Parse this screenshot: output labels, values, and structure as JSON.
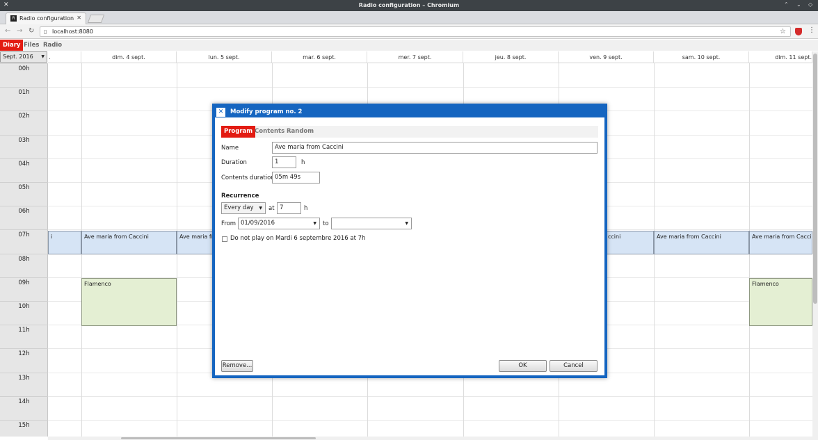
{
  "window": {
    "title": "Radio configuration – Chromium"
  },
  "tab": {
    "favicon": "R",
    "title": "Radio configuration"
  },
  "address_bar": {
    "url": "localhost:8080"
  },
  "app_menu": [
    {
      "label": "Diary",
      "active": true
    },
    {
      "label": "Files",
      "active": false
    },
    {
      "label": "Radio",
      "active": false
    }
  ],
  "calendar": {
    "month_select": "Sept. 2016",
    "partial_left_header": ".",
    "days": [
      "dim. 4 sept.",
      "lun. 5 sept.",
      "mar. 6 sept.",
      "mer. 7 sept.",
      "jeu. 8 sept.",
      "ven. 9 sept.",
      "sam. 10 sept.",
      "dim. 11 sept."
    ],
    "hours": [
      "00h",
      "01h",
      "02h",
      "03h",
      "04h",
      "05h",
      "06h",
      "07h",
      "08h",
      "09h",
      "10h",
      "11h",
      "12h",
      "13h",
      "14h",
      "15h"
    ],
    "events": {
      "partial_left": "i",
      "ave_sun4": "Ave maria from Caccini",
      "ave_mon5": "Ave maria fr",
      "ave_fri9": "ccini",
      "ave_sat10": "Ave maria from Caccini",
      "ave_sun11": "Ave maria from Cacci",
      "flamenco_sun4": "Flamenco",
      "flamenco_sun11": "Flamenco"
    }
  },
  "dialog": {
    "title": "Modify program no. 2",
    "tabs": [
      "Program",
      "Contents",
      "Random"
    ],
    "name_label": "Name",
    "name_value": "Ave maria from Caccini",
    "duration_label": "Duration",
    "duration_value": "1",
    "duration_unit": "h",
    "contents_duration_label": "Contents duration",
    "contents_duration_value": "05m 49s",
    "recurrence_heading": "Recurrence",
    "recurrence_value": "Every day",
    "at_label": "at",
    "at_value": "7",
    "at_unit": "h",
    "from_label": "From",
    "from_value": "01/09/2016",
    "to_label": "to",
    "to_value": "",
    "skip_label": "Do not play on Mardi 6 septembre 2016 at 7h",
    "remove_button": "Remove...",
    "ok_button": "OK",
    "cancel_button": "Cancel"
  }
}
